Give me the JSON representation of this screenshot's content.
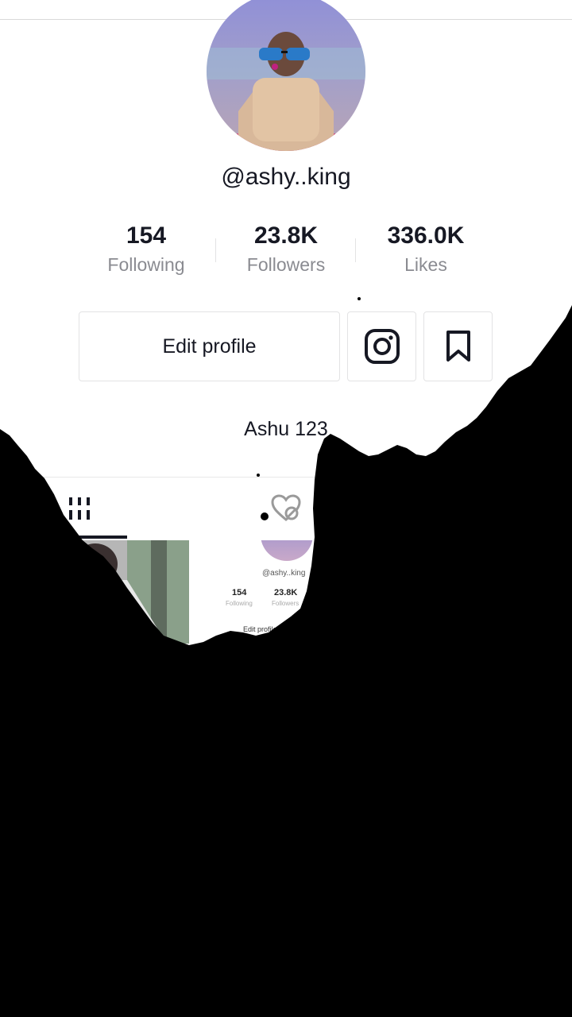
{
  "profile": {
    "username": "@ashy..king",
    "bio": "Ashu 123"
  },
  "stats": [
    {
      "value": "154",
      "label": "Following"
    },
    {
      "value": "23.8K",
      "label": "Followers"
    },
    {
      "value": "336.0K",
      "label": "Likes"
    }
  ],
  "actions": {
    "edit_profile_label": "Edit profile",
    "instagram_icon": "instagram-icon",
    "bookmark_icon": "bookmark-icon"
  },
  "tabs": [
    {
      "icon": "grid-videos-icon",
      "selected": true
    },
    {
      "icon": "liked-hidden-icon",
      "selected": false
    }
  ],
  "thumbnails": {
    "mini_profile": {
      "username": "@ashy..king",
      "following": "154",
      "following_label": "Following",
      "followers": "23.8K",
      "followers_label": "Followers",
      "edit_label": "Edit profile"
    }
  },
  "colors": {
    "text": "#161823",
    "secondary_text": "#8a8b91",
    "border": "#e3e3e4",
    "overlay": "#000000"
  }
}
